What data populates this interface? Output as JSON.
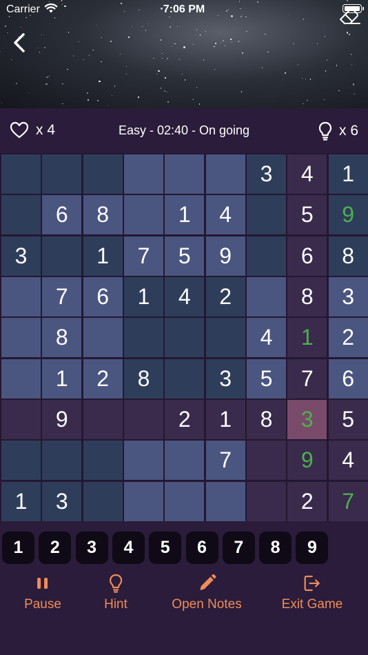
{
  "status_bar": {
    "carrier": "Carrier",
    "time": "7:06 PM"
  },
  "info": {
    "lives": "x 4",
    "status": "Easy - 02:40 - On going",
    "hints": "x 6"
  },
  "colors": {
    "block_a_empty": "#2e3e5a",
    "block_a_filled": "#2e3e5a",
    "block_b_empty": "#4a5680",
    "block_b_filled": "#4a5680",
    "block_c_empty": "#3a2a4c",
    "highlight": "#7a4a6a",
    "correct_digit": "#4caf50",
    "accent": "#ef8c5a"
  },
  "board": [
    [
      "",
      "",
      "",
      "",
      "",
      "",
      "3",
      "4",
      "1"
    ],
    [
      "",
      "6",
      "8",
      "",
      "1",
      "4",
      "",
      "5",
      "9"
    ],
    [
      "3",
      "",
      "1",
      "7",
      "5",
      "9",
      "",
      "6",
      "8"
    ],
    [
      "",
      "7",
      "6",
      "1",
      "4",
      "2",
      "",
      "8",
      "3"
    ],
    [
      "",
      "8",
      "",
      "",
      "",
      "",
      "4",
      "1",
      "2"
    ],
    [
      "",
      "1",
      "2",
      "8",
      "",
      "3",
      "5",
      "7",
      "6"
    ],
    [
      "",
      "9",
      "",
      "",
      "2",
      "1",
      "8",
      "3",
      "5"
    ],
    [
      "",
      "",
      "",
      "",
      "",
      "7",
      "",
      "9",
      "4"
    ],
    [
      "1",
      "3",
      "",
      "",
      "",
      "",
      "",
      "2",
      "7"
    ]
  ],
  "user_entered_green": [
    [
      1,
      8
    ],
    [
      4,
      7
    ],
    [
      6,
      7
    ],
    [
      7,
      7
    ],
    [
      8,
      8
    ]
  ],
  "selected_cell": [
    6,
    7
  ],
  "numpad": [
    "1",
    "2",
    "3",
    "4",
    "5",
    "6",
    "7",
    "8",
    "9"
  ],
  "actions": {
    "pause": "Pause",
    "hint": "Hint",
    "notes": "Open Notes",
    "exit": "Exit Game"
  }
}
